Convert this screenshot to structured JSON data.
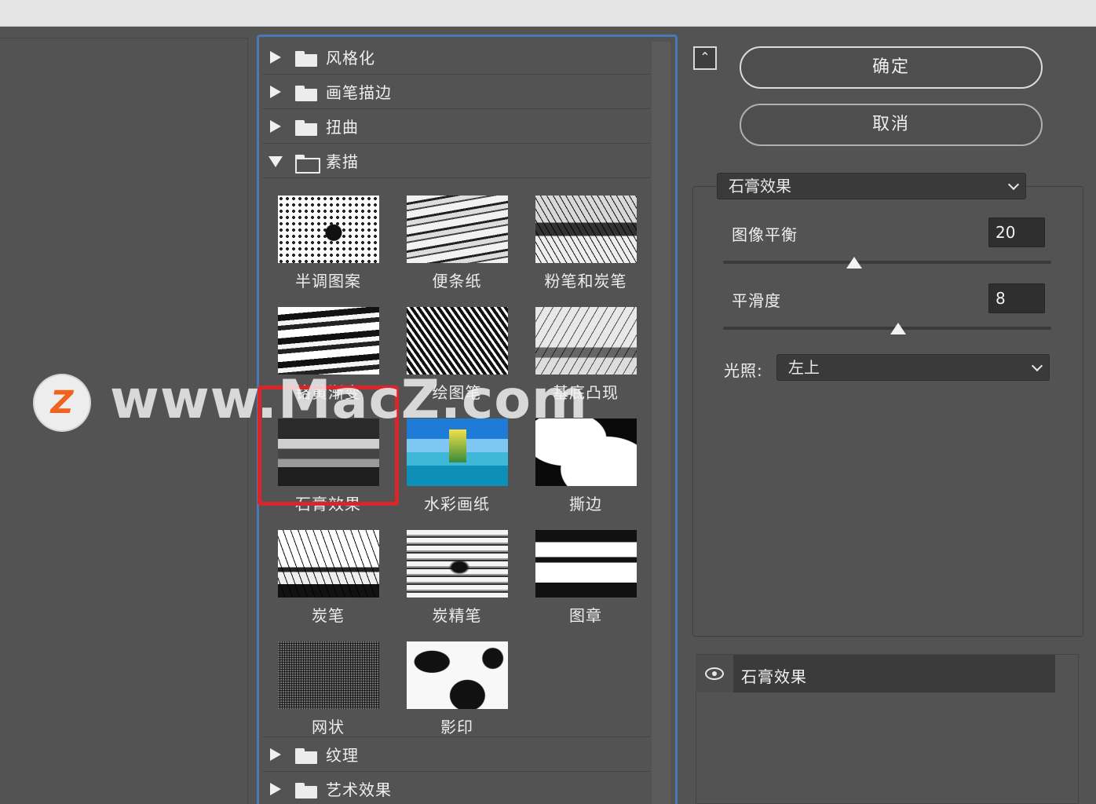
{
  "gallery": {
    "folders_top": [
      {
        "label": "风格化"
      },
      {
        "label": "画笔描边"
      },
      {
        "label": "扭曲"
      },
      {
        "label": "素描"
      }
    ],
    "sketch_filters": [
      {
        "label": "半调图案",
        "icon": "halftone"
      },
      {
        "label": "便条纸",
        "icon": "note"
      },
      {
        "label": "粉笔和炭笔",
        "icon": "chalk"
      },
      {
        "label": "铬黄渐变",
        "icon": "chrome"
      },
      {
        "label": "绘图笔",
        "icon": "graphic"
      },
      {
        "label": "基底凸现",
        "icon": "bas"
      },
      {
        "label": "石膏效果",
        "icon": "plaster"
      },
      {
        "label": "水彩画纸",
        "icon": "water"
      },
      {
        "label": "撕边",
        "icon": "torn"
      },
      {
        "label": "炭笔",
        "icon": "charcoal"
      },
      {
        "label": "炭精笔",
        "icon": "conte"
      },
      {
        "label": "图章",
        "icon": "stamp"
      },
      {
        "label": "网状",
        "icon": "reticul"
      },
      {
        "label": "影印",
        "icon": "photocopy"
      }
    ],
    "folders_bottom": [
      {
        "label": "纹理"
      },
      {
        "label": "艺术效果"
      }
    ],
    "selected": "石膏效果",
    "highlight_color": "#d8262b"
  },
  "watermark": {
    "logo_letter": "Z",
    "text": "www.MacZ.com",
    "logo_color": "#f0631f"
  },
  "buttons": {
    "ok": "确定",
    "cancel": "取消",
    "collapse_icon": "chevron-double-up-icon"
  },
  "settings": {
    "filter_select": "石膏效果",
    "params": [
      {
        "label": "图像平衡",
        "value": "20",
        "max": 50
      },
      {
        "label": "平滑度",
        "value": "8",
        "max": 15
      }
    ],
    "lighting_label": "光照:",
    "lighting_value": "左上"
  },
  "layers": {
    "items": [
      {
        "label": "石膏效果",
        "visible": true
      }
    ]
  },
  "colors": {
    "accent": "#4a78b4",
    "background": "#535353"
  }
}
